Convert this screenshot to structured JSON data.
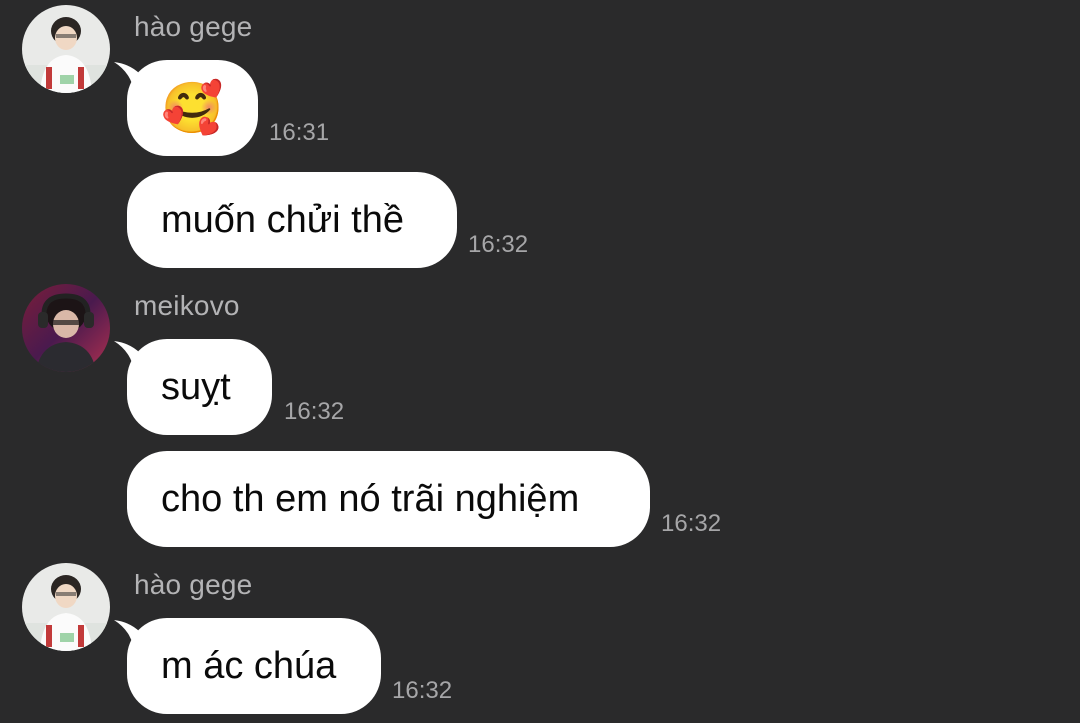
{
  "messages": [
    {
      "sender": "hào gege",
      "avatar": "hao-gege-avatar",
      "text": "🥰",
      "time": "16:31"
    },
    {
      "sender": "",
      "text": "muốn chửi thề",
      "time": "16:32"
    },
    {
      "sender": "meikovo",
      "avatar": "meikovo-avatar",
      "text": "suỵt",
      "time": "16:32"
    },
    {
      "sender": "",
      "text": "cho th em nó trãi nghiệm",
      "time": "16:32"
    },
    {
      "sender": "hào gege",
      "avatar": "hao-gege-avatar",
      "text": "m ác chúa",
      "time": "16:32"
    }
  ],
  "colors": {
    "background": "#2a2a2b",
    "bubble": "#ffffff",
    "sender_text": "#b3b3b5",
    "timestamp_text": "#a6a6a8"
  }
}
